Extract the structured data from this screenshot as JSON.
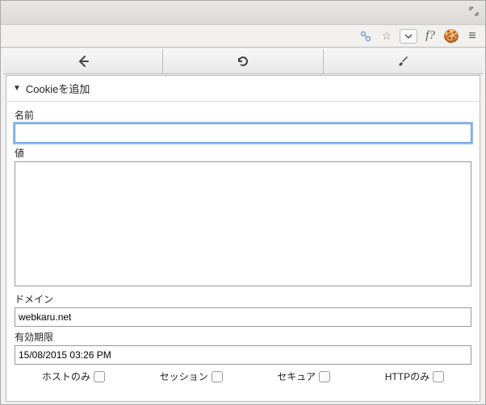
{
  "window": {},
  "toolbar": {
    "back": "←",
    "undo": "↺",
    "settings": "🔧"
  },
  "extensions": {
    "link": "🔗",
    "star": "☆",
    "pocket": "▾",
    "fquery": "f?",
    "cookie": "🍪",
    "menu": "≡"
  },
  "section": {
    "title": "Cookieを追加",
    "triangle": "▼"
  },
  "fields": {
    "name_label": "名前",
    "name_value": "",
    "value_label": "値",
    "value_value": "",
    "domain_label": "ドメイン",
    "domain_value": "webkaru.net",
    "expire_label": "有効期限",
    "expire_value": "15/08/2015 03:26 PM"
  },
  "checkboxes": {
    "host_only": "ホストのみ",
    "session": "セッション",
    "secure": "セキュア",
    "http_only": "HTTPのみ"
  }
}
